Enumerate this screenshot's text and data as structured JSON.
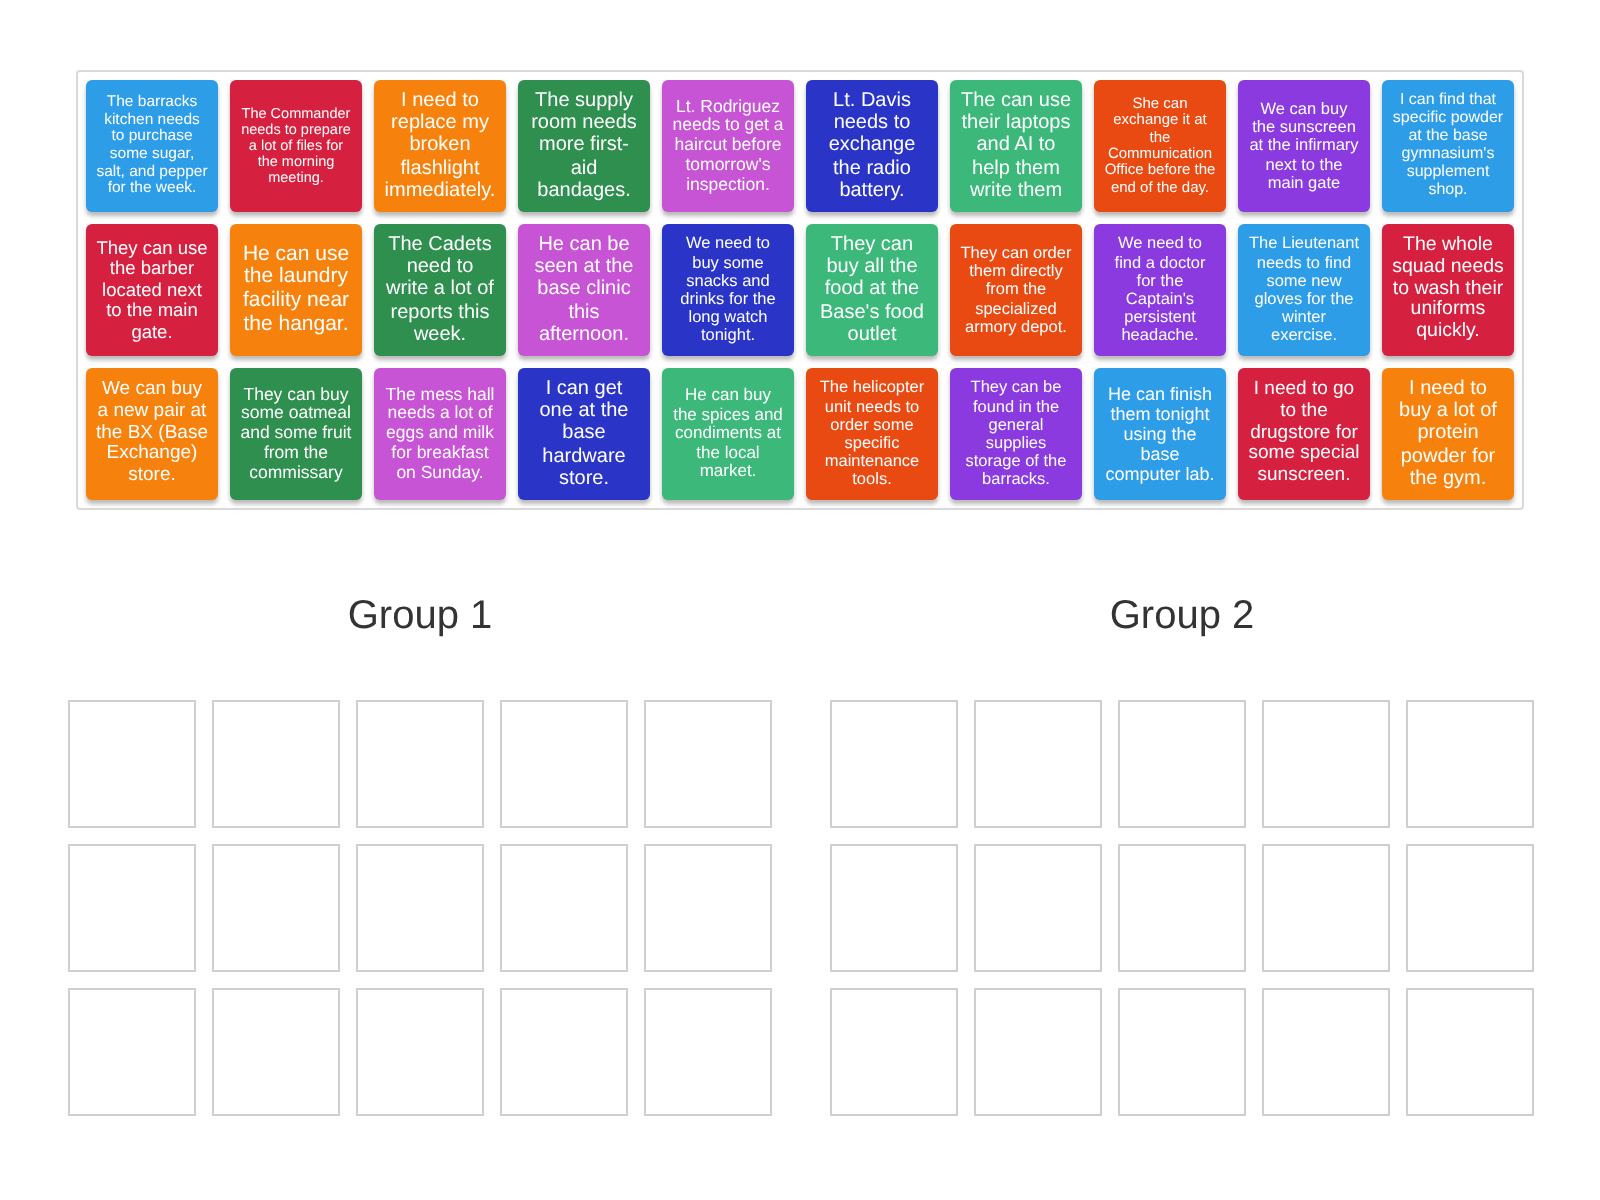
{
  "cards": [
    {
      "text": "The barracks kitchen needs to purchase some sugar, salt, and pepper for the week.",
      "color": "#2d9de8"
    },
    {
      "text": "The Commander needs to prepare a lot of files for the morning meeting.",
      "color": "#d6203f"
    },
    {
      "text": "I need to replace my broken flashlight immediately.",
      "color": "#f6820d"
    },
    {
      "text": "The supply room needs more first-aid bandages.",
      "color": "#2e8f4e"
    },
    {
      "text": "Lt. Rodriguez needs to get a haircut before tomorrow's inspection.",
      "color": "#c753d5"
    },
    {
      "text": "Lt. Davis needs to exchange the radio battery.",
      "color": "#2a35c8"
    },
    {
      "text": "The can use their laptops and AI to help them write them",
      "color": "#3bb87a"
    },
    {
      "text": "She can exchange it at the Communication Office before the end of the day.",
      "color": "#e84a12"
    },
    {
      "text": "We can buy the sunscreen at the infirmary next to the main gate",
      "color": "#8b3ae0"
    },
    {
      "text": "I can find that specific powder at the base gymnasium's supplement shop.",
      "color": "#2d9de8"
    },
    {
      "text": "They can use the barber located next to the main gate.",
      "color": "#d6203f"
    },
    {
      "text": "He can use the laundry facility near the hangar.",
      "color": "#f6820d"
    },
    {
      "text": "The Cadets need to write a lot of reports this week.",
      "color": "#2e8f4e"
    },
    {
      "text": "He can be seen at the base clinic this afternoon.",
      "color": "#c753d5"
    },
    {
      "text": "We need to buy some snacks and drinks for the long watch tonight.",
      "color": "#2a35c8"
    },
    {
      "text": "They can buy all the food at the Base's food outlet",
      "color": "#3bb87a"
    },
    {
      "text": "They can order them directly from the specialized armory depot.",
      "color": "#e84a12"
    },
    {
      "text": "We need to find a doctor for the Captain's persistent headache.",
      "color": "#8b3ae0"
    },
    {
      "text": "The Lieutenant needs to find some new gloves for the winter exercise.",
      "color": "#2d9de8"
    },
    {
      "text": "The whole squad needs to wash their uniforms quickly.",
      "color": "#d6203f"
    },
    {
      "text": "We can buy a new pair at the BX (Base Exchange) store.",
      "color": "#f6820d"
    },
    {
      "text": "They can buy some oatmeal and some fruit from the commissary",
      "color": "#2e8f4e"
    },
    {
      "text": "The mess hall needs a lot of eggs and milk for breakfast on Sunday.",
      "color": "#c753d5"
    },
    {
      "text": "I can get one at the base hardware store.",
      "color": "#2a35c8"
    },
    {
      "text": "He can buy the spices and condiments at the local market.",
      "color": "#3bb87a"
    },
    {
      "text": "The helicopter unit needs to order some specific maintenance tools.",
      "color": "#e84a12"
    },
    {
      "text": "They can be found in the general supplies storage of the barracks.",
      "color": "#8b3ae0"
    },
    {
      "text": "He can finish them tonight using the base computer lab.",
      "color": "#2d9de8"
    },
    {
      "text": "I need to go to the drugstore for some special sunscreen.",
      "color": "#d6203f"
    },
    {
      "text": "I need to buy a lot of protein powder for the gym.",
      "color": "#f6820d"
    }
  ],
  "groups": [
    {
      "title": "Group 1"
    },
    {
      "title": "Group 2"
    }
  ]
}
